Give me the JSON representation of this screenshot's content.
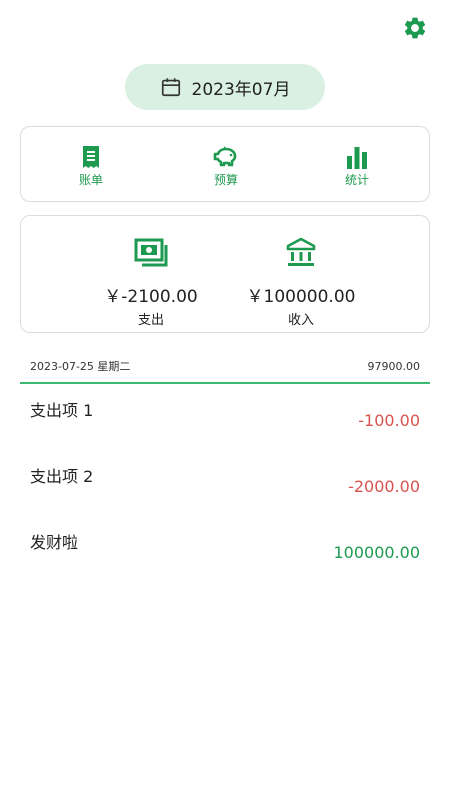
{
  "colors": {
    "accent": "#1e9a50",
    "pill_bg": "#d9f0e2",
    "expense": "#d9534f",
    "income": "#1e9a50"
  },
  "header": {
    "month": "2023年07月"
  },
  "nav": [
    {
      "label": "账单",
      "icon": "receipt-icon"
    },
    {
      "label": "预算",
      "icon": "piggy-bank-icon"
    },
    {
      "label": "统计",
      "icon": "bar-chart-icon"
    }
  ],
  "summary": {
    "expense": {
      "amount": "￥-2100.00",
      "label": "支出",
      "icon": "cash-icon"
    },
    "income": {
      "amount": "￥100000.00",
      "label": "收入",
      "icon": "bank-icon"
    }
  },
  "day": {
    "date": "2023-07-25 星期二",
    "total": "97900.00",
    "entries": [
      {
        "name": "支出项 1",
        "amount": "-100.00",
        "type": "expense"
      },
      {
        "name": "支出项 2",
        "amount": "-2000.00",
        "type": "expense"
      },
      {
        "name": "发财啦",
        "amount": "100000.00",
        "type": "income"
      }
    ]
  }
}
